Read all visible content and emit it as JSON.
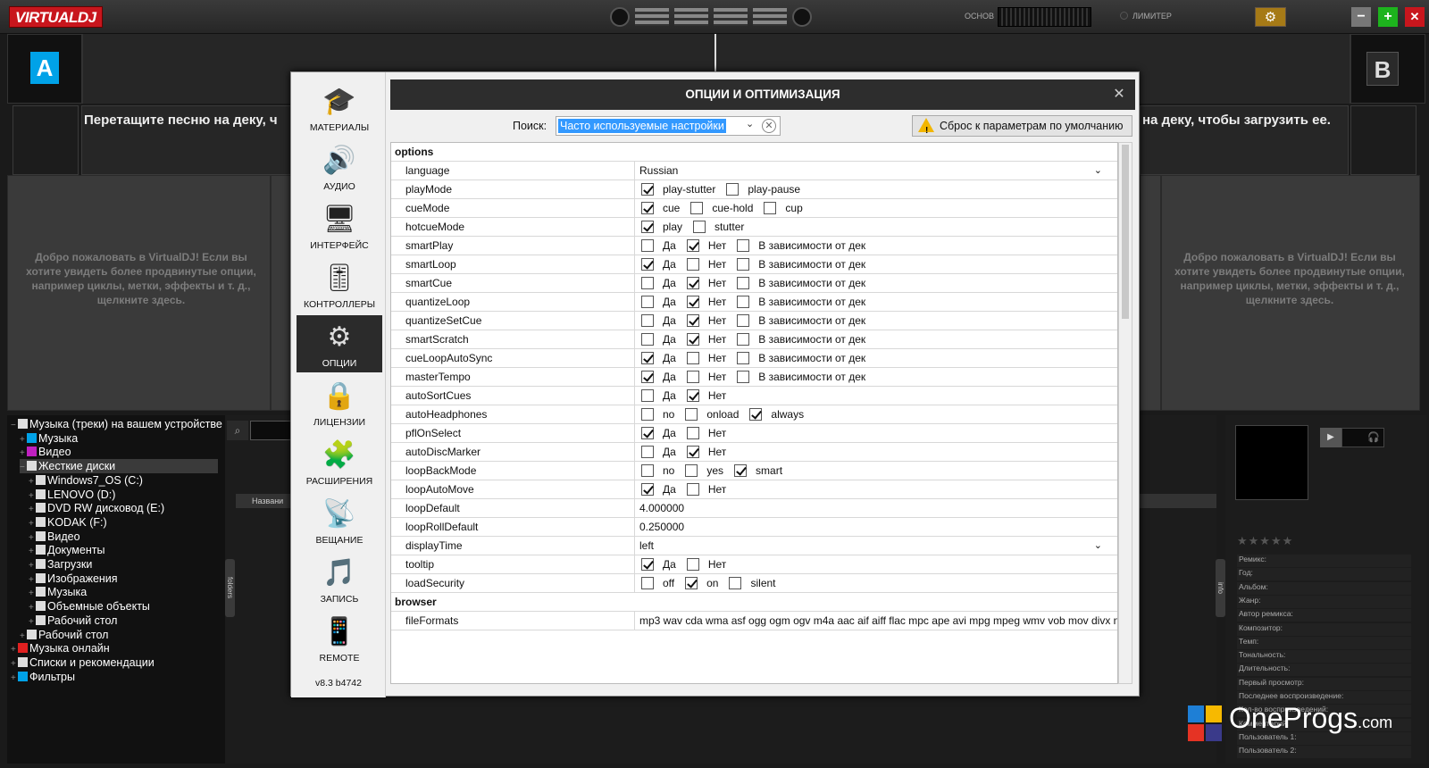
{
  "app": {
    "logo": "VIRTUALDJ",
    "master_label": "ОСНОВ",
    "limiter_label": "ЛИМИТЕР",
    "min": "−",
    "max": "+",
    "close": "✕"
  },
  "decks": {
    "a_letter": "A",
    "b_letter": "B",
    "drop_left": "Перетащите песню на деку, ч",
    "drop_right": "на деку, чтобы загрузить ее.",
    "welcome": "Добро пожаловать в VirtualDJ! Если вы хотите увидеть более продвинутые опции, например циклы, метки, эффекты и т. д., щелкните здесь."
  },
  "tree": [
    {
      "label": "Музыка (треки) на вашем устройстве",
      "indent": 0,
      "color": "#ddd"
    },
    {
      "label": "Музыка",
      "indent": 1,
      "color": "#00a2e8"
    },
    {
      "label": "Видео",
      "indent": 1,
      "color": "#c020c0"
    },
    {
      "label": "Жесткие диски",
      "indent": 1,
      "color": "#ddd"
    },
    {
      "label": "Windows7_OS (C:)",
      "indent": 2,
      "color": "#ddd"
    },
    {
      "label": "LENOVO (D:)",
      "indent": 2,
      "color": "#ddd"
    },
    {
      "label": "DVD RW дисковод (E:)",
      "indent": 2,
      "color": "#ddd"
    },
    {
      "label": "KODAK (F:)",
      "indent": 2,
      "color": "#ddd"
    },
    {
      "label": "Видео",
      "indent": 2,
      "color": "#ddd"
    },
    {
      "label": "Документы",
      "indent": 2,
      "color": "#ddd"
    },
    {
      "label": "Загрузки",
      "indent": 2,
      "color": "#ddd"
    },
    {
      "label": "Изображения",
      "indent": 2,
      "color": "#ddd"
    },
    {
      "label": "Музыка",
      "indent": 2,
      "color": "#ddd"
    },
    {
      "label": "Объемные объекты",
      "indent": 2,
      "color": "#ddd"
    },
    {
      "label": "Рабочий стол",
      "indent": 2,
      "color": "#ddd"
    },
    {
      "label": "Рабочий стол",
      "indent": 1,
      "color": "#ddd"
    },
    {
      "label": "Музыка онлайн",
      "indent": 0,
      "color": "#e02020"
    },
    {
      "label": "Списки и рекомендации",
      "indent": 0,
      "color": "#ddd"
    },
    {
      "label": "Фильтры",
      "indent": 0,
      "color": "#00a2e8"
    }
  ],
  "browser": {
    "col_name": "Названи",
    "folders_tab": "folders",
    "info_tab": "info"
  },
  "info_fields": [
    "Ремикс:",
    "Год:",
    "Альбом:",
    "Жанр:",
    "Автор ремикса:",
    "Композитор:",
    "Темп:",
    "Тональность:",
    "Длительность:",
    "Первый просмотр:",
    "Последнее воспроизведение:",
    "Кол-во воспроизведений:",
    "Комментарий:",
    "Пользователь 1:",
    "Пользователь 2:"
  ],
  "dialog": {
    "title": "ОПЦИИ И ОПТИМИЗАЦИЯ",
    "close": "✕",
    "search_label": "Поиск:",
    "search_value": "Часто используемые настройки",
    "reset_label": "Сброс к параметрам по умолчанию",
    "version": "v8.3 b4742",
    "nav": [
      {
        "label": "МАТЕРИАЛЫ",
        "icon": "🎓",
        "name": "graduation-cap-icon"
      },
      {
        "label": "АУДИО",
        "icon": "🔊",
        "name": "speaker-icon"
      },
      {
        "label": "ИНТЕРФЕЙС",
        "icon": "🖥",
        "name": "monitor-icon"
      },
      {
        "label": "КОНТРОЛЛЕРЫ",
        "icon": "🎚",
        "name": "sliders-icon"
      },
      {
        "label": "ОПЦИИ",
        "icon": "⚙",
        "name": "gear-icon"
      },
      {
        "label": "ЛИЦЕНЗИИ",
        "icon": "🔒",
        "name": "lock-icon"
      },
      {
        "label": "РАСШИРЕНИЯ",
        "icon": "🧩",
        "name": "puzzle-icon"
      },
      {
        "label": "ВЕЩАНИЕ",
        "icon": "📡",
        "name": "broadcast-icon"
      },
      {
        "label": "ЗАПИСЬ",
        "icon": "🎵",
        "name": "record-folder-icon"
      },
      {
        "label": "REMOTE",
        "icon": "📱",
        "name": "phone-icon"
      }
    ],
    "selected_nav": 4,
    "rows": [
      {
        "group": "options"
      },
      {
        "name": "language",
        "type": "dropdown",
        "value": "Russian"
      },
      {
        "name": "playMode",
        "type": "checks",
        "opts": [
          [
            "play-stutter",
            true
          ],
          [
            "play-pause",
            false
          ]
        ]
      },
      {
        "name": "cueMode",
        "type": "checks",
        "opts": [
          [
            "cue",
            true
          ],
          [
            "cue-hold",
            false
          ],
          [
            "cup",
            false
          ]
        ]
      },
      {
        "name": "hotcueMode",
        "type": "checks",
        "opts": [
          [
            "play",
            true
          ],
          [
            "stutter",
            false
          ]
        ]
      },
      {
        "name": "smartPlay",
        "type": "checks",
        "opts": [
          [
            "Да",
            false
          ],
          [
            "Нет",
            true
          ],
          [
            "В зависимости от дек",
            false
          ]
        ]
      },
      {
        "name": "smartLoop",
        "type": "checks",
        "opts": [
          [
            "Да",
            true
          ],
          [
            "Нет",
            false
          ],
          [
            "В зависимости от дек",
            false
          ]
        ]
      },
      {
        "name": "smartCue",
        "type": "checks",
        "opts": [
          [
            "Да",
            false
          ],
          [
            "Нет",
            true
          ],
          [
            "В зависимости от дек",
            false
          ]
        ]
      },
      {
        "name": "quantizeLoop",
        "type": "checks",
        "opts": [
          [
            "Да",
            false
          ],
          [
            "Нет",
            true
          ],
          [
            "В зависимости от дек",
            false
          ]
        ]
      },
      {
        "name": "quantizeSetCue",
        "type": "checks",
        "opts": [
          [
            "Да",
            false
          ],
          [
            "Нет",
            true
          ],
          [
            "В зависимости от дек",
            false
          ]
        ]
      },
      {
        "name": "smartScratch",
        "type": "checks",
        "opts": [
          [
            "Да",
            false
          ],
          [
            "Нет",
            true
          ],
          [
            "В зависимости от дек",
            false
          ]
        ]
      },
      {
        "name": "cueLoopAutoSync",
        "type": "checks",
        "opts": [
          [
            "Да",
            true
          ],
          [
            "Нет",
            false
          ],
          [
            "В зависимости от дек",
            false
          ]
        ]
      },
      {
        "name": "masterTempo",
        "type": "checks",
        "opts": [
          [
            "Да",
            true
          ],
          [
            "Нет",
            false
          ],
          [
            "В зависимости от дек",
            false
          ]
        ]
      },
      {
        "name": "autoSortCues",
        "type": "checks",
        "opts": [
          [
            "Да",
            false
          ],
          [
            "Нет",
            true
          ]
        ]
      },
      {
        "name": "autoHeadphones",
        "type": "checks",
        "opts": [
          [
            "no",
            false
          ],
          [
            "onload",
            false
          ],
          [
            "always",
            true
          ]
        ]
      },
      {
        "name": "pflOnSelect",
        "type": "checks",
        "opts": [
          [
            "Да",
            true
          ],
          [
            "Нет",
            false
          ]
        ]
      },
      {
        "name": "autoDiscMarker",
        "type": "checks",
        "opts": [
          [
            "Да",
            false
          ],
          [
            "Нет",
            true
          ]
        ]
      },
      {
        "name": "loopBackMode",
        "type": "checks",
        "opts": [
          [
            "no",
            false
          ],
          [
            "yes",
            false
          ],
          [
            "smart",
            true
          ]
        ]
      },
      {
        "name": "loopAutoMove",
        "type": "checks",
        "opts": [
          [
            "Да",
            true
          ],
          [
            "Нет",
            false
          ]
        ]
      },
      {
        "name": "loopDefault",
        "type": "text",
        "value": "4.000000"
      },
      {
        "name": "loopRollDefault",
        "type": "text",
        "value": "0.250000"
      },
      {
        "name": "displayTime",
        "type": "dropdown",
        "value": "left"
      },
      {
        "name": "tooltip",
        "type": "checks",
        "opts": [
          [
            "Да",
            true
          ],
          [
            "Нет",
            false
          ]
        ]
      },
      {
        "name": "loadSecurity",
        "type": "checks",
        "opts": [
          [
            "off",
            false
          ],
          [
            "on",
            true
          ],
          [
            "silent",
            false
          ]
        ]
      },
      {
        "group": "browser"
      },
      {
        "name": "fileFormats",
        "type": "text",
        "value": "mp3 wav cda wma asf ogg ogm ogv m4a aac aif aiff flac mpc ape avi mpg mpeg wmv vob mov divx n"
      }
    ]
  }
}
